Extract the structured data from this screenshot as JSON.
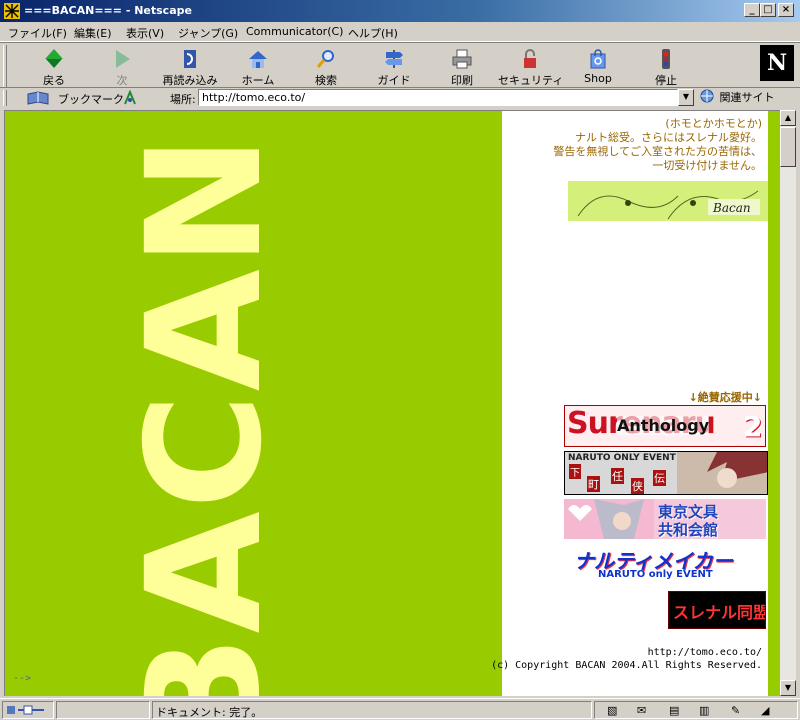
{
  "window": {
    "title": "===BACAN=== - Netscape"
  },
  "menu": [
    "ファイル(F)",
    "編集(E)",
    "表示(V)",
    "ジャンプ(G)",
    "Communicator(C)",
    "ヘルプ(H)"
  ],
  "toolbar": {
    "back": "戻る",
    "forward": "次",
    "reload": "再読み込み",
    "home": "ホーム",
    "search": "検索",
    "guide": "ガイド",
    "print": "印刷",
    "security": "セキュリティ",
    "shop": "Shop",
    "stop": "停止"
  },
  "logo_letter": "N",
  "location": {
    "bookmarks": "ブックマーク",
    "label": "場所:",
    "url": "http://tomo.eco.to/",
    "related": "関連サイト"
  },
  "content": {
    "big_word": "BACAN",
    "notice_lines": [
      "(ホモとかホモとか)",
      "ナルト総受。さらにはスレナル愛好。",
      "警告を無視してご入室された方の苦情は、",
      "一切受け付けません。"
    ],
    "art_banner_text": "Bacan",
    "support_label": "↓絶賛応援中↓",
    "banners": {
      "surenaru_big": "Surenaru",
      "surenaru_sub": "Anthology",
      "surenaru_num": "2",
      "naruto_event": "NARUTO ONLY EVENT",
      "naruto_kanji": [
        "下",
        "町",
        "任",
        "侠",
        "伝"
      ],
      "tokyo_line1": "東京文具",
      "tokyo_line2": "共和会館",
      "narutime": "ナルティメイカー",
      "narutime_sub": "NARUTO only EVENT",
      "surenaru_alliance": "スレナル同盟"
    },
    "footer_url": "http://tomo.eco.to/",
    "footer_copy": "(c) Copyright BACAN 2004.All Rights Reserved.",
    "comment_tail": "-->"
  },
  "status": {
    "text": "ドキュメント: 完了。"
  },
  "colors": {
    "page_bg": "#99cc00",
    "big_word": "#ffff99",
    "notice_text": "#996600"
  }
}
